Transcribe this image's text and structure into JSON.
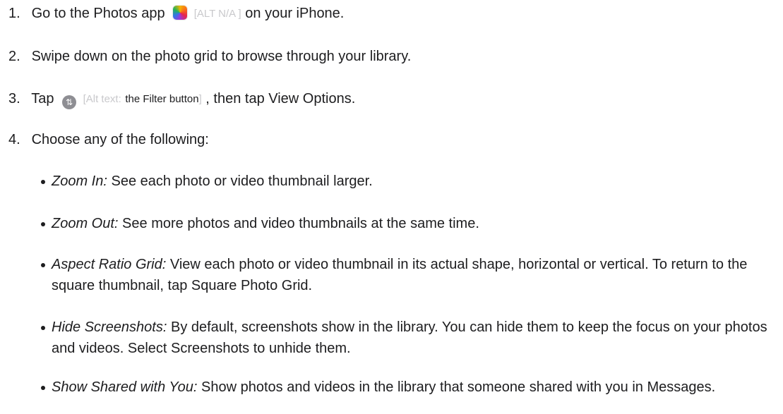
{
  "steps": [
    {
      "num": "1.",
      "before": "Go to the Photos app",
      "alt": "[ALT N/A ]",
      "after": "on your iPhone."
    },
    {
      "num": "2.",
      "text": "Swipe down on the photo grid to browse through your library."
    },
    {
      "num": "3.",
      "before": "Tap",
      "alt_prefix": "[Alt text:",
      "alt_value": "the Filter button",
      "alt_suffix": "]",
      "after": ", then tap View Options."
    },
    {
      "num": "4.",
      "text": "Choose any of the following:"
    }
  ],
  "icons": {
    "photos": "photos-app-icon",
    "filter": "filter-icon",
    "filter_glyph": "⇅"
  },
  "options": [
    {
      "term": "Zoom In:",
      "desc": "See each photo or video thumbnail larger."
    },
    {
      "term": "Zoom Out:",
      "desc": "See more photos and video thumbnails at the same time."
    },
    {
      "term": "Aspect Ratio Grid:",
      "desc": "View each photo or video thumbnail in its actual shape, horizontal or vertical. To return to the square thumbnail, tap Square Photo Grid."
    },
    {
      "term": "Hide Screenshots:",
      "desc": "By default, screenshots show in the library. You can hide them to keep the focus on your photos and videos. Select Screenshots to unhide them."
    },
    {
      "term": "Show Shared with You:",
      "desc": "Show photos and videos in the library that someone shared with you in Messages."
    }
  ]
}
